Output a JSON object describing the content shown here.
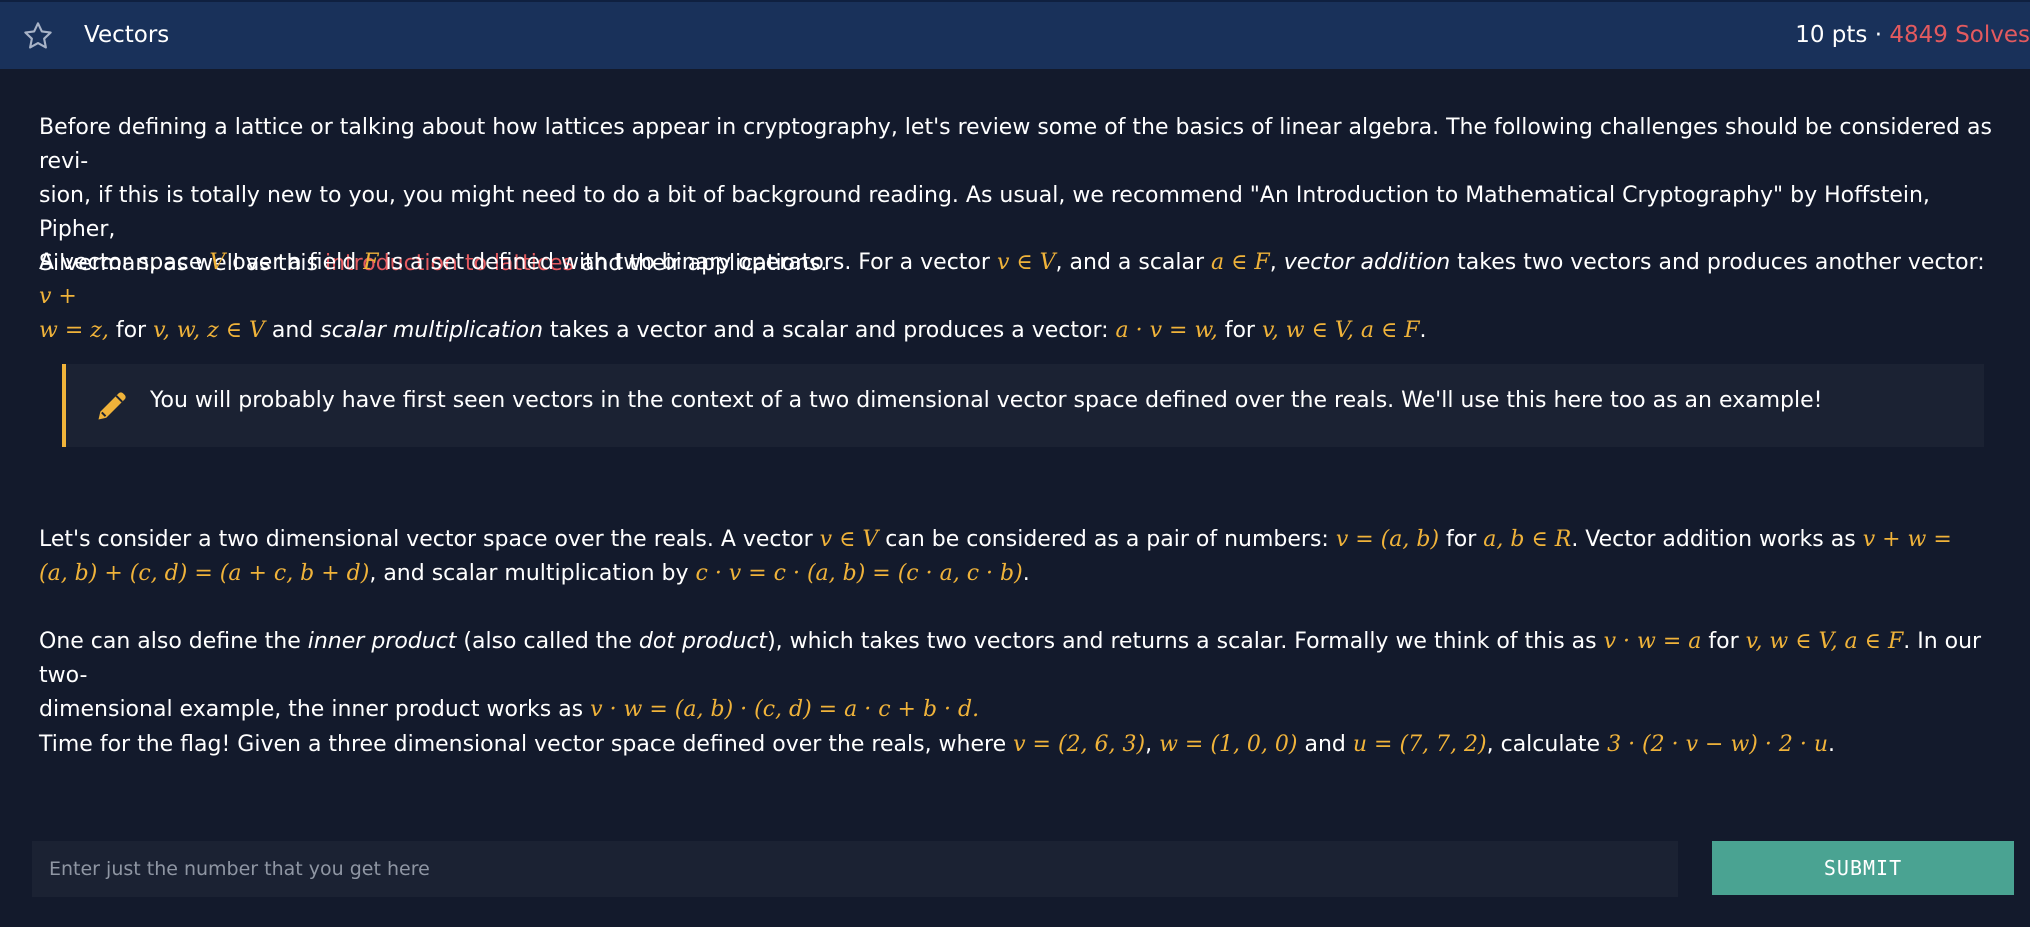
{
  "header": {
    "star_icon": "star-outline-icon",
    "title": "Vectors",
    "points": "10 pts",
    "separator": "·",
    "solves": "4849 Solves",
    "solves_color": "#e35a5f"
  },
  "content": {
    "p1": {
      "line1": "Before defining a lattice or talking about how lattices appear in cryptography, let's review some of the basics of linear algebra. The following challenges should be considered as revi-",
      "line2": "sion, if this is totally new to you, you might need to do a bit of background reading. As usual, we recommend \"An Introduction to Mathematical Cryptography\" by Hoffstein, Pipher,",
      "line3_pre": "Silverman, as well as this ",
      "link": "introduction to lattices",
      "line3_post": " and their applications."
    },
    "p2": {
      "t1": "A vector space ",
      "m1": "V",
      "t2": " over a field ",
      "m2": "F",
      "t3": " is a set defined with two binary operators. For a vector ",
      "m3": "v ∈ V",
      "t4": ", and a scalar ",
      "m4": "a ∈ F",
      "t5": ", ",
      "e1": "vector addition",
      "t6": " takes two vectors and produces another vector: ",
      "m5": "v +",
      "m6": "w = z,",
      "t7": " for ",
      "m7": "v, w, z ∈ V",
      "t8": " and ",
      "e2": "scalar multiplication",
      "t9": " takes a vector and a scalar and produces a vector: ",
      "m8": "a · v = w,",
      "t10": " for ",
      "m9": "v, w ∈ V, a ∈ F",
      "t11": "."
    },
    "note": {
      "icon": "pencil-icon",
      "text": "You will probably have first seen vectors in the context of a two dimensional vector space defined over the reals. We'll use this here too as an example!",
      "accent_color": "#f0b33a"
    },
    "p3": {
      "t1": "Let's consider a two dimensional vector space over the reals. A vector ",
      "m1": "v ∈ V",
      "t2": " can be considered as a pair of numbers: ",
      "m2": "v = (a, b)",
      "t3": " for ",
      "m3": "a, b ∈ R",
      "t4": ". Vector addition works as ",
      "m4": "v + w =",
      "m5": "(a, b) + (c, d) = (a + c, b + d)",
      "t5": ", and scalar multiplication by ",
      "m6": "c · v = c · (a, b) = (c · a, c · b)",
      "t6": "."
    },
    "p4": {
      "t1": "One can also define the ",
      "e1": "inner product",
      "t2": " (also called the ",
      "e2": "dot product",
      "t3": "), which takes two vectors and returns a scalar. Formally we think of this as ",
      "m1": "v · w = a",
      "t4": " for ",
      "m2": "v, w ∈ V, a ∈ F",
      "t5": ". In our two-",
      "t6": "dimensional example, the inner product works as ",
      "m3": "v · w = (a, b) · (c, d) = a · c + b · d.",
      "t7": ""
    },
    "p5": {
      "t1": "Time for the flag! Given a three dimensional vector space defined over the reals, where ",
      "m1": "v = (2, 6, 3)",
      "t2": ", ",
      "m2": "w = (1, 0, 0)",
      "t3": " and ",
      "m3": "u = (7, 7, 2)",
      "t4": ", calculate ",
      "m4": "3 · (2 · v − w) · 2 · u",
      "t5": "."
    }
  },
  "form": {
    "placeholder": "Enter just the number that you get here",
    "value": "",
    "submit_label": "SUBMIT",
    "submit_color": "#4aa392"
  }
}
